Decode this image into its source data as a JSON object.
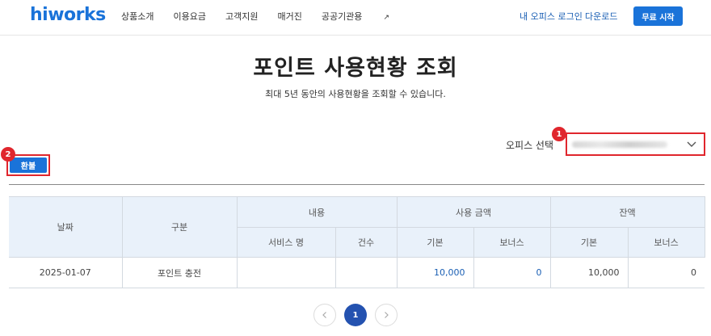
{
  "header": {
    "logo": "hiworks",
    "nav": [
      "상품소개",
      "이용요금",
      "고객지원",
      "매거진",
      "공공기관용"
    ],
    "external_mark": "↗",
    "login_link": "내 오피스 로그인",
    "download_link": "다운로드",
    "start_button": "무료 시작"
  },
  "page": {
    "title": "포인트 사용현황 조회",
    "subtitle": "최대 5년 동안의 사용현황을 조회할 수 있습니다."
  },
  "office": {
    "label": "오피스 선택",
    "selected_value": "",
    "chevron_icon": "chevron-down-icon"
  },
  "annotations": {
    "badge_1": "1",
    "badge_2": "2"
  },
  "refund_button": "환불",
  "table": {
    "headers": {
      "date": "날짜",
      "category": "구분",
      "content": "내용",
      "usage_amount": "사용 금액",
      "balance": "잔액",
      "service_name": "서비스 명",
      "count": "건수",
      "usage_basic": "기본",
      "usage_bonus": "보너스",
      "balance_basic": "기본",
      "balance_bonus": "보너스"
    },
    "rows": [
      {
        "date": "2025-01-07",
        "category": "포인트 충전",
        "service_name": "",
        "count": "",
        "usage_basic": "10,000",
        "usage_bonus": "0",
        "balance_basic": "10,000",
        "balance_bonus": "0"
      }
    ]
  },
  "pagination": {
    "current_page": "1",
    "prev_icon": "chevron-left-icon",
    "next_icon": "chevron-right-icon"
  },
  "colors": {
    "brand": "#1a73d9",
    "highlight": "#e0262d",
    "header_bg": "#e9f1fa",
    "page_active": "#2452b0"
  }
}
